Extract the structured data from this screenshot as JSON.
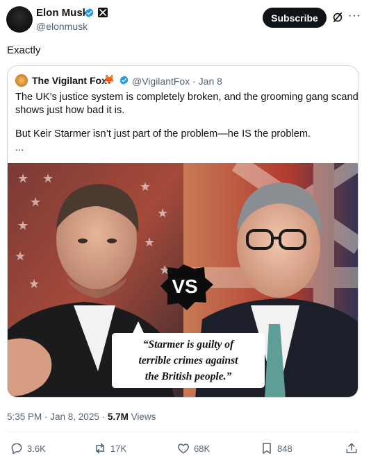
{
  "post": {
    "author_name": "Elon Musk",
    "author_handle": "@elonmusk",
    "subscribe_label": "Subscribe",
    "more_label": "···",
    "text": "Exactly"
  },
  "quote": {
    "author_name": "The Vigilant Fox",
    "author_emoji": "🦊",
    "handle_date": "@VigilantFox · Jan 8",
    "lines": [
      "The UK’s justice system is completely broken, and the grooming gang scandal",
      "shows just how bad it is.",
      "But Keir Starmer isn’t just part of the problem—he IS the problem.",
      "..."
    ],
    "image": {
      "badge": "VS",
      "quote_lines": [
        "“Starmer is guilty of",
        "terrible crimes against",
        "the British people.”"
      ]
    }
  },
  "meta": {
    "time_date": "5:35 PM · Jan 8, 2025 · ",
    "views_count": "5.7M",
    "views_label": " Views"
  },
  "actions": {
    "replies": "3.6K",
    "reposts": "17K",
    "likes": "68K",
    "bookmarks": "848"
  },
  "colors": {
    "verified_blue": "#1d9bf0",
    "text_primary": "#0f1419",
    "text_secondary": "#536471"
  },
  "icons": [
    "verified-icon",
    "x-logo-icon",
    "grok-icon",
    "more-icon",
    "reply-icon",
    "repost-icon",
    "like-icon",
    "bookmark-icon",
    "share-icon"
  ]
}
